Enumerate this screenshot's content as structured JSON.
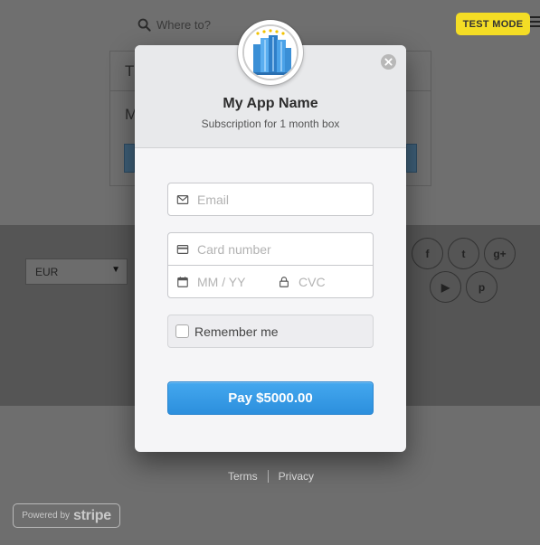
{
  "background": {
    "search_placeholder": "Where to?",
    "card_title_partial": "T",
    "card_body_partial": "M",
    "currency": "EUR",
    "social_icons": [
      "facebook-icon",
      "twitter-icon",
      "google-plus-icon",
      "youtube-icon",
      "pinterest-icon"
    ],
    "social_glyphs": [
      "f",
      "t",
      "g+",
      "▶",
      "p"
    ],
    "links": {
      "terms": "Terms",
      "privacy": "Privacy"
    }
  },
  "badge": {
    "label": "TEST MODE",
    "color": "#f4dd25"
  },
  "modal": {
    "title": "My App Name",
    "subtitle": "Subscription for 1 month box",
    "email_placeholder": "Email",
    "card_placeholder": "Card number",
    "exp_placeholder": "MM / YY",
    "cvc_placeholder": "CVC",
    "remember_label": "Remember me",
    "pay_label": "Pay $5000.00",
    "accent": "#3a9be6"
  },
  "powered_by": {
    "prefix": "Powered by",
    "brand": "stripe"
  }
}
